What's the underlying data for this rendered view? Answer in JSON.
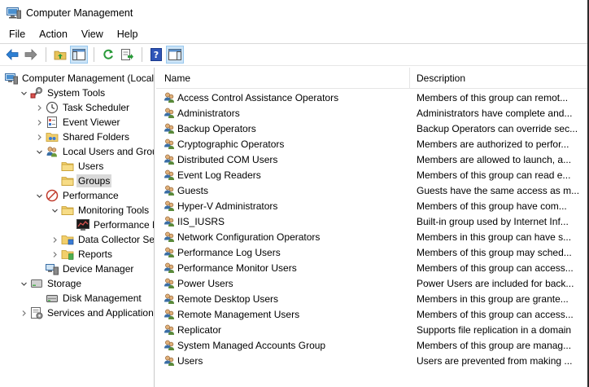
{
  "window": {
    "title": "Computer Management"
  },
  "menu": [
    "File",
    "Action",
    "View",
    "Help"
  ],
  "toolbar": {
    "icons": [
      "back-arrow-icon",
      "forward-arrow-icon",
      "up-folder-icon",
      "show-hide-tree-icon",
      "refresh-icon",
      "export-list-icon",
      "help-icon",
      "show-hide-action-pane-icon"
    ]
  },
  "tree": [
    {
      "label": "Computer Management (Local",
      "icon": "computer-management-icon",
      "level": 0,
      "expander": ""
    },
    {
      "label": "System Tools",
      "icon": "system-tools-icon",
      "level": 1,
      "expander": "open"
    },
    {
      "label": "Task Scheduler",
      "icon": "clock-icon",
      "level": 2,
      "expander": "closed"
    },
    {
      "label": "Event Viewer",
      "icon": "event-viewer-icon",
      "level": 2,
      "expander": "closed"
    },
    {
      "label": "Shared Folders",
      "icon": "shared-folder-icon",
      "level": 2,
      "expander": "closed"
    },
    {
      "label": "Local Users and Groups",
      "icon": "users-groups-icon",
      "level": 2,
      "expander": "open"
    },
    {
      "label": "Users",
      "icon": "folder-icon",
      "level": 3,
      "expander": ""
    },
    {
      "label": "Groups",
      "icon": "folder-icon",
      "level": 3,
      "expander": "",
      "selected": true
    },
    {
      "label": "Performance",
      "icon": "performance-icon",
      "level": 2,
      "expander": "open"
    },
    {
      "label": "Monitoring Tools",
      "icon": "folder-icon",
      "level": 3,
      "expander": "open"
    },
    {
      "label": "Performance Mo",
      "icon": "monitor-chart-icon",
      "level": 4,
      "expander": ""
    },
    {
      "label": "Data Collector Sets",
      "icon": "data-collector-icon",
      "level": 3,
      "expander": "closed"
    },
    {
      "label": "Reports",
      "icon": "reports-icon",
      "level": 3,
      "expander": "closed"
    },
    {
      "label": "Device Manager",
      "icon": "device-manager-icon",
      "level": 2,
      "expander": ""
    },
    {
      "label": "Storage",
      "icon": "storage-icon",
      "level": 1,
      "expander": "open"
    },
    {
      "label": "Disk Management",
      "icon": "disk-management-icon",
      "level": 2,
      "expander": ""
    },
    {
      "label": "Services and Applications",
      "icon": "services-icon",
      "level": 1,
      "expander": "closed"
    }
  ],
  "list": {
    "columns": {
      "name": "Name",
      "description": "Description"
    },
    "rows": [
      {
        "name": "Access Control Assistance Operators",
        "description": "Members of this group can remot..."
      },
      {
        "name": "Administrators",
        "description": "Administrators have complete and..."
      },
      {
        "name": "Backup Operators",
        "description": "Backup Operators can override sec..."
      },
      {
        "name": "Cryptographic Operators",
        "description": "Members are authorized to perfor..."
      },
      {
        "name": "Distributed COM Users",
        "description": "Members are allowed to launch, a..."
      },
      {
        "name": "Event Log Readers",
        "description": "Members of this group can read e..."
      },
      {
        "name": "Guests",
        "description": "Guests have the same access as m..."
      },
      {
        "name": "Hyper-V Administrators",
        "description": "Members of this group have com..."
      },
      {
        "name": "IIS_IUSRS",
        "description": "Built-in group used by Internet Inf..."
      },
      {
        "name": "Network Configuration Operators",
        "description": "Members in this group can have s..."
      },
      {
        "name": "Performance Log Users",
        "description": "Members of this group may sched..."
      },
      {
        "name": "Performance Monitor Users",
        "description": "Members of this group can access..."
      },
      {
        "name": "Power Users",
        "description": "Power Users are included for back..."
      },
      {
        "name": "Remote Desktop Users",
        "description": "Members in this group are grante..."
      },
      {
        "name": "Remote Management Users",
        "description": "Members of this group can access..."
      },
      {
        "name": "Replicator",
        "description": "Supports file replication in a domain"
      },
      {
        "name": "System Managed Accounts Group",
        "description": "Members of this group are manag..."
      },
      {
        "name": "Users",
        "description": "Users are prevented from making ..."
      }
    ]
  }
}
